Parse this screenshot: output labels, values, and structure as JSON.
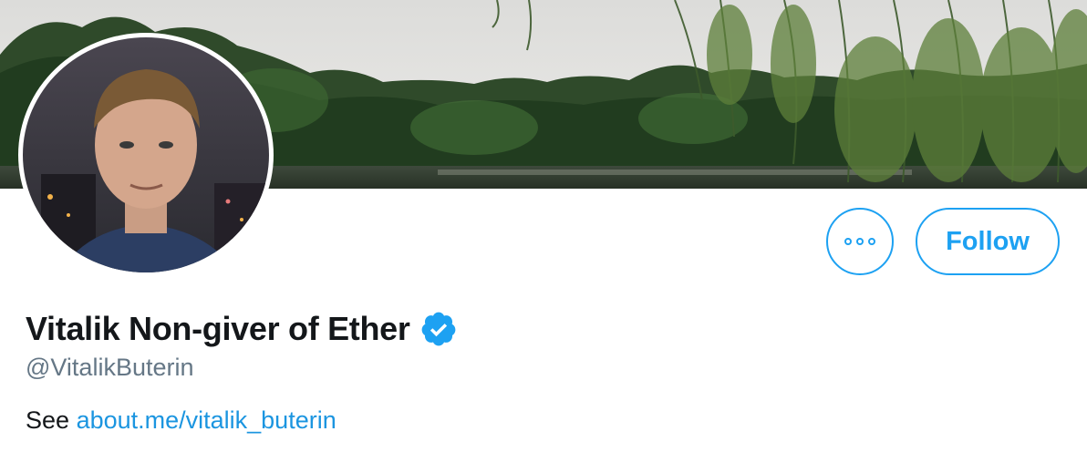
{
  "profile": {
    "display_name": "Vitalik Non-giver of Ether",
    "handle": "@VitalikButerin",
    "bio_prefix": "See",
    "bio_link": "about.me/vitalik_buterin",
    "verified_icon": "verified-badge-icon",
    "avatar_icon": "profile-photo",
    "banner_icon": "lake-trees-photo"
  },
  "actions": {
    "more_icon": "more-options-icon",
    "follow_label": "Follow"
  },
  "colors": {
    "accent": "#1da1f2",
    "link": "#1b95e0",
    "name_text": "#14171a",
    "secondary_text": "#657786"
  }
}
